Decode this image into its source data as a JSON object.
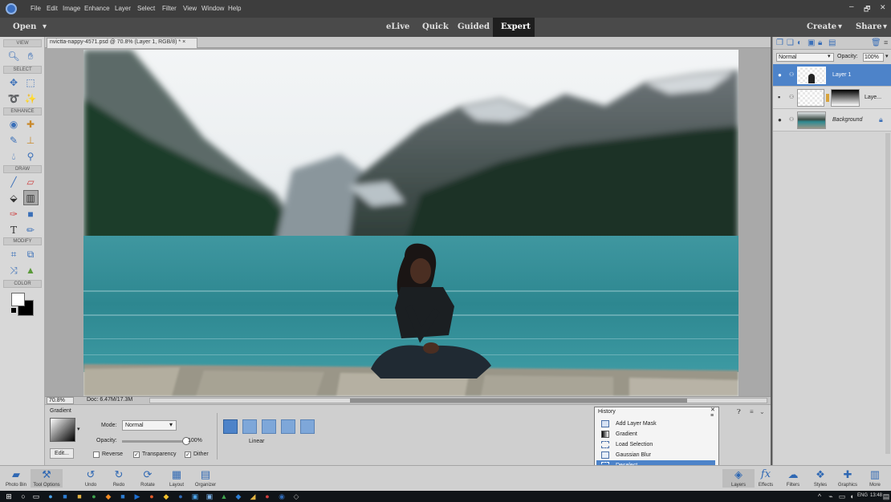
{
  "menu": {
    "items": [
      "File",
      "Edit",
      "Image",
      "Enhance",
      "Layer",
      "Select",
      "Filter",
      "View",
      "Window",
      "Help"
    ],
    "window_controls": [
      "–",
      "🗗",
      "✕"
    ]
  },
  "modebar": {
    "open_label": "Open",
    "modes": [
      "eLive",
      "Quick",
      "Guided",
      "Expert"
    ],
    "active_mode": "Expert",
    "create_label": "Create",
    "share_label": "Share"
  },
  "toolbox": {
    "sections": [
      "VIEW",
      "SELECT",
      "ENHANCE",
      "DRAW",
      "MODIFY",
      "COLOR"
    ]
  },
  "document": {
    "tab_title": "nvictta-nappy-4571.psd @ 70.8% (Layer 1, RGB/8) * ×",
    "zoom": "70.8%",
    "doc_info": "Doc: 6.47M/17.3M"
  },
  "layers_panel": {
    "blend_mode": "Normal",
    "opacity_label": "Opacity:",
    "opacity_value": "100%",
    "layers": [
      {
        "name": "Layer 1",
        "selected": true
      },
      {
        "name": "Laye...",
        "selected": false
      },
      {
        "name": "Background",
        "selected": false
      }
    ]
  },
  "tool_options": {
    "tool_name": "Gradient",
    "edit_label": "Edit...",
    "mode_label": "Mode:",
    "mode_value": "Normal",
    "opacity_label": "Opacity:",
    "opacity_value": "100%",
    "opacity_fraction": 1.0,
    "reverse_label": "Reverse",
    "transparency_label": "Transparency",
    "dither_label": "Dither",
    "gradient_type": "Linear"
  },
  "history": {
    "title": "History",
    "items": [
      "Add Layer Mask",
      "Gradient",
      "Load Selection",
      "Gaussian Blur",
      "Deselect"
    ],
    "selected_index": 4
  },
  "bottombar": {
    "left": [
      "Photo Bin",
      "Tool Options",
      "Undo",
      "Redo",
      "Rotate",
      "Layout",
      "Organizer"
    ],
    "right": [
      "Layers",
      "Effects",
      "Filters",
      "Styles",
      "Graphics",
      "More"
    ]
  },
  "taskbar": {
    "language": "ENG",
    "time": "13:48"
  },
  "colors": {
    "accent": "#3a6fb8",
    "selection": "#4d83c9",
    "water": "#2f8a92",
    "forest": "#1e3a2e"
  }
}
